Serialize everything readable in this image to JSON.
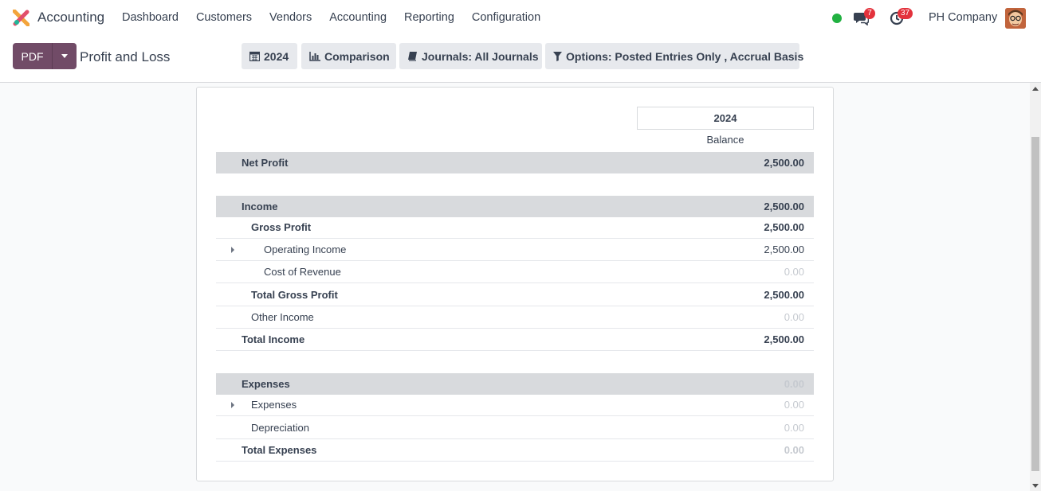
{
  "app": {
    "name": "Accounting"
  },
  "menu": [
    "Dashboard",
    "Customers",
    "Vendors",
    "Accounting",
    "Reporting",
    "Configuration"
  ],
  "systray": {
    "messages_count": "7",
    "activities_count": "37",
    "company": "PH Company",
    "presence_color": "#21b141"
  },
  "control": {
    "pdf_label": "PDF",
    "title": "Profit and Loss",
    "filters": {
      "year": "2024",
      "comparison": "Comparison",
      "journals": "Journals: All Journals",
      "options": "Options: Posted Entries Only , Accrual Basis"
    }
  },
  "report": {
    "column_period": "2024",
    "column_label": "Balance",
    "rows": [
      {
        "label": "Net Profit",
        "value": "2,500.00"
      },
      {
        "label": "Income",
        "value": "2,500.00"
      },
      {
        "label": "Gross Profit",
        "value": "2,500.00"
      },
      {
        "label": "Operating Income",
        "value": "2,500.00"
      },
      {
        "label": "Cost of Revenue",
        "value": "0.00"
      },
      {
        "label": "Total Gross Profit",
        "value": "2,500.00"
      },
      {
        "label": "Other Income",
        "value": "0.00"
      },
      {
        "label": "Total Income",
        "value": "2,500.00"
      },
      {
        "label": "Expenses",
        "value": "0.00"
      },
      {
        "label": "Expenses",
        "value": "0.00"
      },
      {
        "label": "Depreciation",
        "value": "0.00"
      },
      {
        "label": "Total Expenses",
        "value": "0.00"
      }
    ]
  },
  "colors": {
    "brand": "#714b67",
    "header_row": "#d8dadd",
    "badge": "#e3323c"
  }
}
